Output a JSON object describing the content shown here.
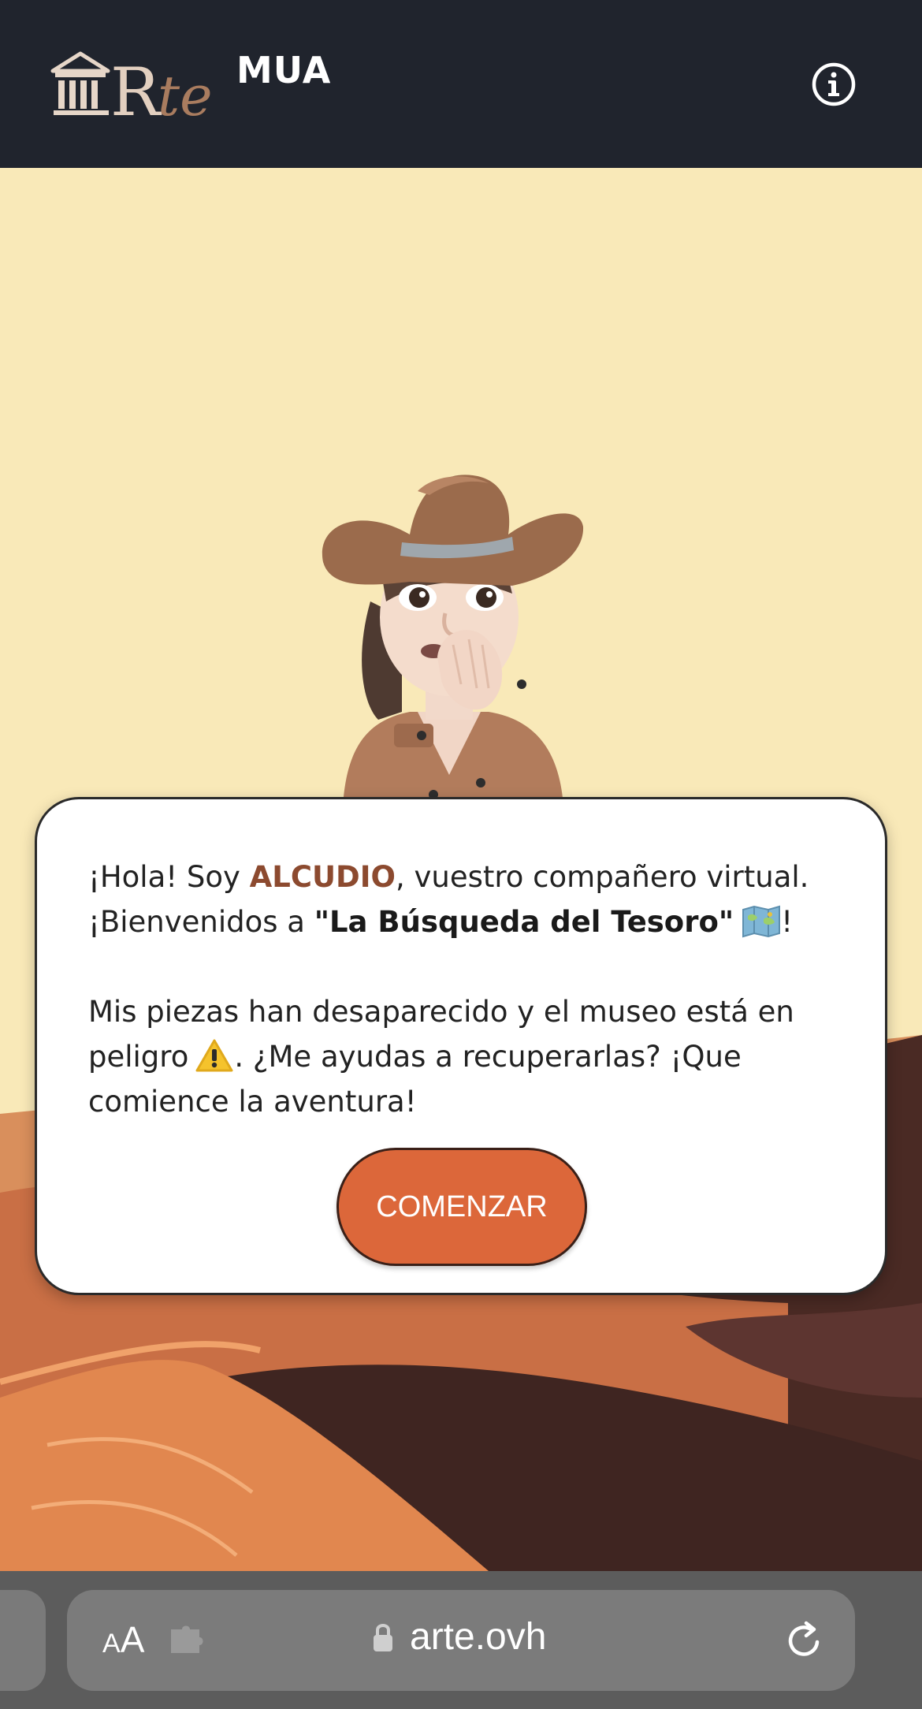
{
  "app": {
    "logo_text": "MUA",
    "logo_letters": "Rte"
  },
  "dialog": {
    "p1_prefix": "¡Hola! Soy ",
    "p1_name": "ALCUDIO",
    "p1_suffix": ", vuestro compañero virtual. ¡Bienvenidos a ",
    "p1_title": "\"La Búsqueda del Tesoro\"",
    "p1_end": "!",
    "p2_prefix": "Mis piezas han desaparecido y el museo está en peligro",
    "p2_suffix": ". ¿Me ayudas a recuperarlas? ¡Que comience la aventura!",
    "start_label": "COMENZAR"
  },
  "browser": {
    "aa_small": "A",
    "aa_big": "A",
    "url": "arte.ovh"
  },
  "icons": {
    "info": "info-icon",
    "logo": "museum-building-icon",
    "map_emoji": "world-map-emoji",
    "warning_emoji": "warning-emoji",
    "extension": "puzzle-piece-icon",
    "lock": "lock-icon",
    "reload": "reload-icon"
  },
  "colors": {
    "header_bg": "#20242d",
    "accent_button": "#dc673a",
    "name_highlight": "#8c4a2f",
    "scene_sky": "#f9e9b8"
  }
}
